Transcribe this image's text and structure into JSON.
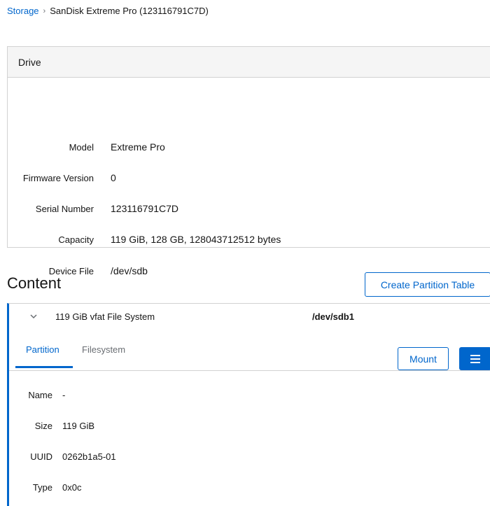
{
  "breadcrumb": {
    "root": "Storage",
    "separator": "›",
    "current": "SanDisk Extreme Pro (123116791C7D)"
  },
  "drive": {
    "header": "Drive",
    "rows": [
      {
        "label": "Model",
        "value": "Extreme Pro"
      },
      {
        "label": "Firmware Version",
        "value": "0"
      },
      {
        "label": "Serial Number",
        "value": "123116791C7D"
      },
      {
        "label": "Capacity",
        "value": "119 GiB, 128 GB, 128043712512 bytes"
      },
      {
        "label": "Device File",
        "value": "/dev/sdb"
      }
    ]
  },
  "content": {
    "title": "Content",
    "create_partition_table_label": "Create Partition Table",
    "filesystem": {
      "name": "119 GiB vfat File System",
      "device": "/dev/sdb1",
      "expand_icon": "chevron-down-icon"
    },
    "tabs": [
      {
        "label": "Partition",
        "active": true
      },
      {
        "label": "Filesystem",
        "active": false
      }
    ],
    "mount_label": "Mount",
    "menu_icon": "hamburger-icon",
    "partition_rows": [
      {
        "label": "Name",
        "value": "-"
      },
      {
        "label": "Size",
        "value": "119 GiB"
      },
      {
        "label": "UUID",
        "value": "0262b1a5-01"
      },
      {
        "label": "Type",
        "value": "0x0c"
      }
    ]
  },
  "colors": {
    "accent": "#0066cc",
    "border": "#d2d2d2",
    "header_bg": "#f5f5f5",
    "text": "#151515"
  }
}
